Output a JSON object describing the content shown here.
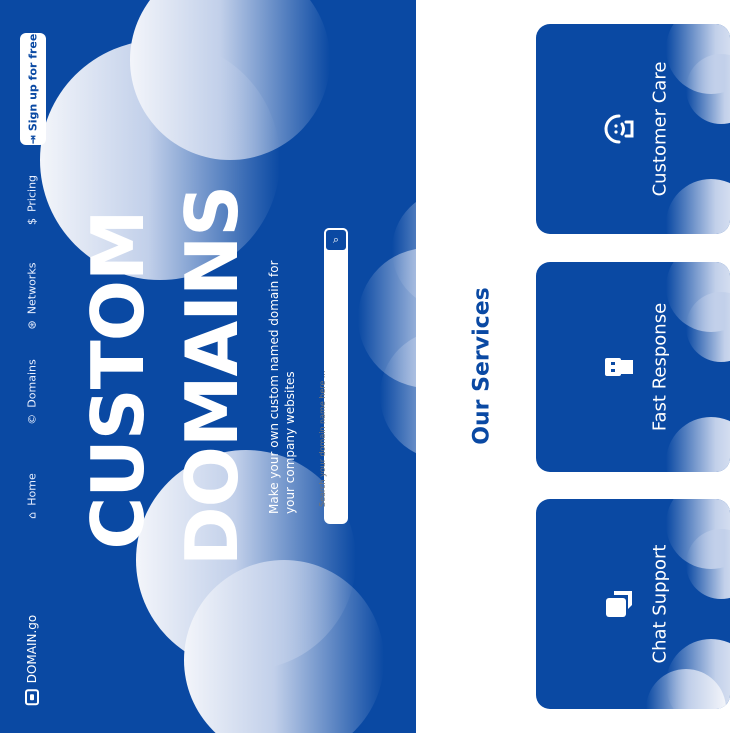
{
  "brand": {
    "name": "DOMAIN.go",
    "icon": "browser-icon"
  },
  "nav": {
    "items": [
      {
        "label": "Home",
        "icon": "home-icon"
      },
      {
        "label": "Domains",
        "icon": "copyright-icon"
      },
      {
        "label": "Networks",
        "icon": "antenna-icon"
      },
      {
        "label": "Pricing",
        "icon": "dollar-icon"
      }
    ],
    "signup_label": "Sign up for free",
    "signup_icon": "login-icon"
  },
  "hero": {
    "title_line1": "CUSTOM",
    "title_line2": "DOMAINS",
    "tagline": "Make your own custom named domain for your company websites",
    "search_placeholder": "Search your domain name here ...",
    "search_icon": "search-icon"
  },
  "services": {
    "title": "Our Services",
    "cards": [
      {
        "label": "Customer Care",
        "icon": "headset-icon"
      },
      {
        "label": "Fast Response",
        "icon": "usb-icon"
      },
      {
        "label": "Chat Support",
        "icon": "chat-icon"
      }
    ]
  },
  "colors": {
    "primary": "#0a49a3",
    "background": "#ffffff",
    "cloud": "#eef2fa"
  }
}
